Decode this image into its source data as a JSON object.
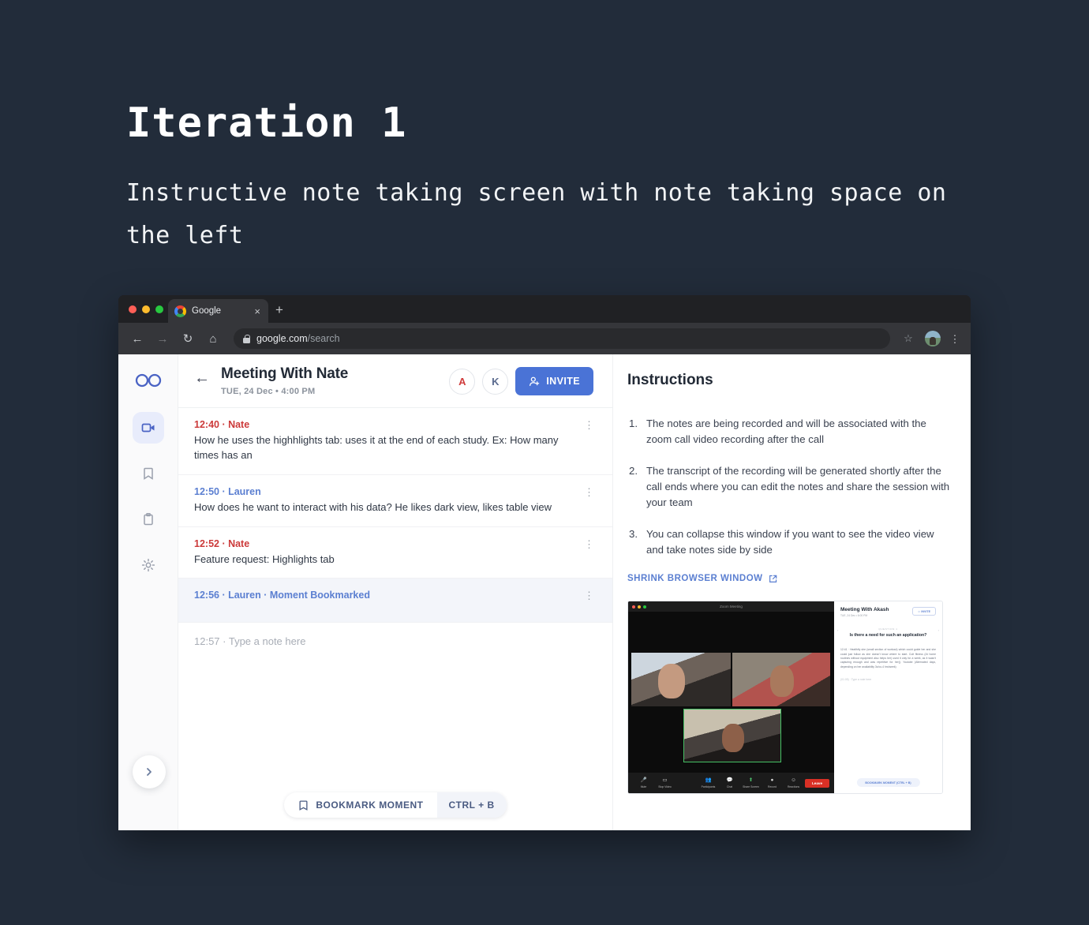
{
  "slide": {
    "title": "Iteration 1",
    "subtitle": "Instructive note taking screen with note taking space on the left"
  },
  "browser": {
    "tab": {
      "label": "Google",
      "favicon": "google-icon",
      "close": "×"
    },
    "new_tab": "+",
    "nav": {
      "back": "←",
      "forward": "→",
      "reload": "↻",
      "home": "⌂"
    },
    "address": {
      "domain": "google.com",
      "path": "/search"
    },
    "star": "☆",
    "menu": "⋮"
  },
  "sidebar": {
    "logo": "infinity-logo",
    "items": [
      {
        "name": "video",
        "active": true
      },
      {
        "name": "bookmark",
        "active": false
      },
      {
        "name": "clipboard",
        "active": false
      },
      {
        "name": "settings",
        "active": false
      }
    ],
    "collapse": "›"
  },
  "meeting": {
    "back": "←",
    "title": "Meeting With Nate",
    "date": "TUE, 24 Dec • 4:00 PM",
    "participants": [
      {
        "initial": "A",
        "color": "#d03b3b"
      },
      {
        "initial": "K",
        "color": "#5b6b8f"
      }
    ],
    "invite_label": "INVITE"
  },
  "notes": [
    {
      "time": "12:40",
      "author": "Nate",
      "author_color": "#cc3a3a",
      "meta": "12:40 · Nate",
      "text": "How he uses the highhlights tab: uses it at the end of each study. Ex: How many times has an",
      "bookmarked": false
    },
    {
      "time": "12:50",
      "author": "Lauren",
      "author_color": "#5b7fd1",
      "meta": "12:50 · Lauren",
      "text": "How does he want to interact with his data? He likes dark view, likes table view",
      "bookmarked": false
    },
    {
      "time": "12:52",
      "author": "Nate",
      "author_color": "#cc3a3a",
      "meta": "12:52 · Nate",
      "text": "Feature request: Highlights tab",
      "bookmarked": false
    },
    {
      "time": "12:56",
      "author": "Lauren",
      "author_color": "#5b7fd1",
      "meta": "12:56 · Lauren · Moment Bookmarked",
      "text": "",
      "bookmarked": true
    }
  ],
  "note_input": {
    "placeholder": "12:57 · Type a note here"
  },
  "bottom_bar": {
    "bookmark_label": "BOOKMARK MOMENT",
    "shortcut": "CTRL + B"
  },
  "instructions": {
    "title": "Instructions",
    "items": [
      "The notes are being recorded and will be associated with the zoom call video recording after the call",
      "The transcript of the recording will be generated shortly after the call ends where you can edit the notes and share the session with your team",
      "You can collapse this window if you want to see the video view and take notes side by side"
    ],
    "shrink_link": "SHRINK BROWSER WINDOW"
  },
  "preview": {
    "window_title": "Zoom Meeting",
    "meeting_title": "Meeting With Akash",
    "meeting_date": "TUE, 24 Dec • 6:00 PM",
    "invite_label": "INVITE",
    "question_label": "QUESTION 1",
    "question": "Is there a need for such an application?",
    "note": "12:41 · Healthify she (small section of workout) which could guide her and she could just follow as she doesn't know where to start. Cult fitness (At home routines without equipment also helps her) used it only for a week, as it wasn't capturing enough and was repetitive for her(). Youtube (Alternated days, depending on her availability 3x/co-4 hrs/week)",
    "note_placeholder": "(01:05) · Type a note here",
    "bookmark_label": "BOOKMARK MOMENT (CTRL + B)",
    "toolbar": [
      {
        "label": "Mute",
        "icon": "mic-icon"
      },
      {
        "label": "Stop Video",
        "icon": "video-icon"
      },
      {
        "label": "Participants",
        "icon": "people-icon"
      },
      {
        "label": "Chat",
        "icon": "chat-icon"
      },
      {
        "label": "Share Screen",
        "icon": "share-screen-icon"
      },
      {
        "label": "Record",
        "icon": "record-icon"
      },
      {
        "label": "Reactions",
        "icon": "reactions-icon"
      }
    ],
    "leave_label": "Leave"
  },
  "colors": {
    "page_bg": "#222c3a",
    "accent_blue": "#4a73d6",
    "link_blue": "#5b7fd1",
    "red": "#cc3a3a"
  }
}
